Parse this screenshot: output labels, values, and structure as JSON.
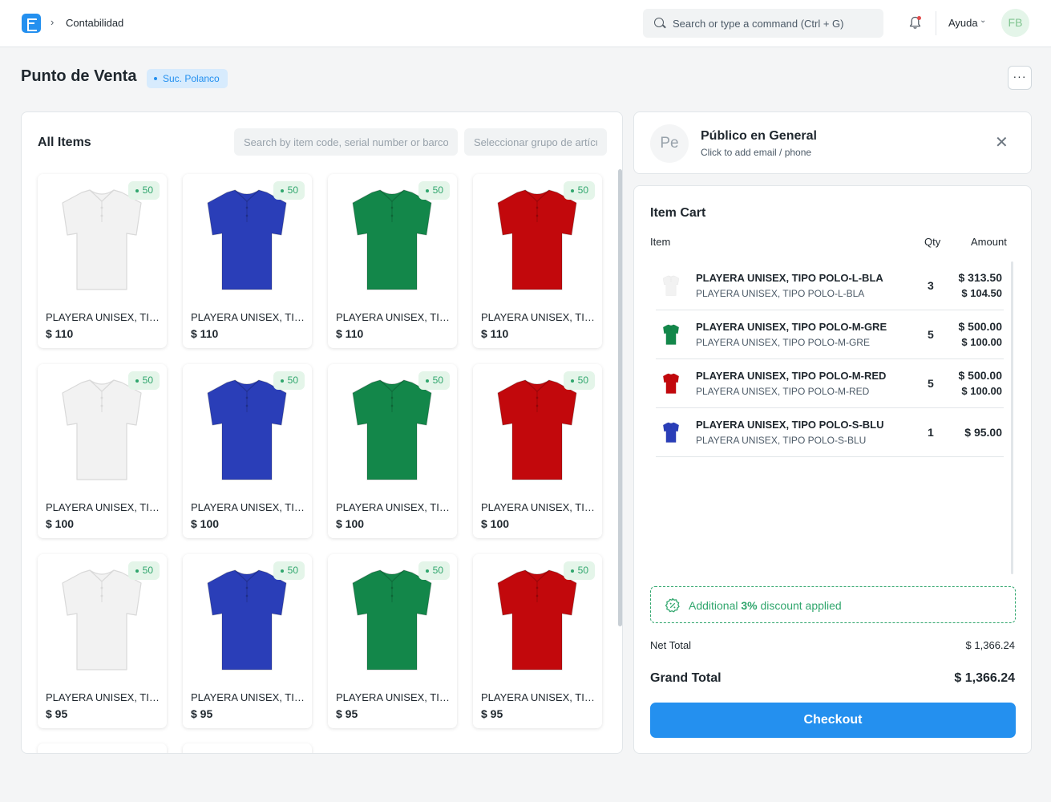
{
  "navbar": {
    "breadcrumb": "Contabilidad",
    "search_placeholder": "Search or type a command (Ctrl + G)",
    "help_label": "Ayuda",
    "avatar_initials": "FB"
  },
  "page": {
    "title": "Punto de Venta",
    "branch_badge": "Suc. Polanco"
  },
  "items_panel": {
    "title": "All Items",
    "search_placeholder": "Search by item code, serial number or barcode",
    "group_placeholder": "Seleccionar grupo de artículos",
    "items": [
      {
        "name": "PLAYERA UNISEX, TIPO POLO-L-BLA",
        "price": "$ 110",
        "stock": "50",
        "color": "#f2f2f2"
      },
      {
        "name": "PLAYERA UNISEX, TIPO POLO-L-BLU",
        "price": "$ 110",
        "stock": "50",
        "color": "#2a3eb8"
      },
      {
        "name": "PLAYERA UNISEX, TIPO POLO-L-GRE",
        "price": "$ 110",
        "stock": "50",
        "color": "#13874a"
      },
      {
        "name": "PLAYERA UNISEX, TIPO POLO-L-RED",
        "price": "$ 110",
        "stock": "50",
        "color": "#c2080c"
      },
      {
        "name": "PLAYERA UNISEX, TIPO POLO-M-BLA",
        "price": "$ 100",
        "stock": "50",
        "color": "#f2f2f2"
      },
      {
        "name": "PLAYERA UNISEX, TIPO POLO-M-BLU",
        "price": "$ 100",
        "stock": "50",
        "color": "#2a3eb8"
      },
      {
        "name": "PLAYERA UNISEX, TIPO POLO-M-GRE",
        "price": "$ 100",
        "stock": "50",
        "color": "#13874a"
      },
      {
        "name": "PLAYERA UNISEX, TIPO POLO-M-RED",
        "price": "$ 100",
        "stock": "50",
        "color": "#c2080c"
      },
      {
        "name": "PLAYERA UNISEX, TIPO POLO-S-BLA",
        "price": "$ 95",
        "stock": "50",
        "color": "#f2f2f2"
      },
      {
        "name": "PLAYERA UNISEX, TIPO POLO-S-BLU",
        "price": "$ 95",
        "stock": "50",
        "color": "#2a3eb8"
      },
      {
        "name": "PLAYERA UNISEX, TIPO POLO-S-GRE",
        "price": "$ 95",
        "stock": "50",
        "color": "#13874a"
      },
      {
        "name": "PLAYERA UNISEX, TIPO POLO-S-RED",
        "price": "$ 95",
        "stock": "50",
        "color": "#c2080c"
      }
    ]
  },
  "customer": {
    "initials": "Pe",
    "name": "Público en General",
    "subtitle": "Click to add email / phone"
  },
  "cart": {
    "title": "Item Cart",
    "columns": {
      "item": "Item",
      "qty": "Qty",
      "amount": "Amount"
    },
    "rows": [
      {
        "name": "PLAYERA UNISEX, TIPO POLO-L-BLA",
        "code": "PLAYERA UNISEX, TIPO POLO-L-BLA",
        "qty": "3",
        "amount": "$ 313.50",
        "rate": "$ 104.50",
        "color": "#f2f2f2"
      },
      {
        "name": "PLAYERA UNISEX, TIPO POLO-M-GRE",
        "code": "PLAYERA UNISEX, TIPO POLO-M-GRE",
        "qty": "5",
        "amount": "$ 500.00",
        "rate": "$ 100.00",
        "color": "#13874a"
      },
      {
        "name": "PLAYERA UNISEX, TIPO POLO-M-RED",
        "code": "PLAYERA UNISEX, TIPO POLO-M-RED",
        "qty": "5",
        "amount": "$ 500.00",
        "rate": "$ 100.00",
        "color": "#c2080c"
      },
      {
        "name": "PLAYERA UNISEX, TIPO POLO-S-BLU",
        "code": "PLAYERA UNISEX, TIPO POLO-S-BLU",
        "qty": "1",
        "amount": "$ 95.00",
        "rate": "",
        "color": "#2a3eb8"
      }
    ],
    "discount_prefix": "Additional ",
    "discount_value": "3%",
    "discount_suffix": " discount applied",
    "net_total_label": "Net Total",
    "net_total": "$ 1,366.24",
    "grand_total_label": "Grand Total",
    "grand_total": "$ 1,366.24",
    "checkout_label": "Checkout"
  },
  "colors": {
    "primary": "#2490ef",
    "success": "#30a66d"
  }
}
